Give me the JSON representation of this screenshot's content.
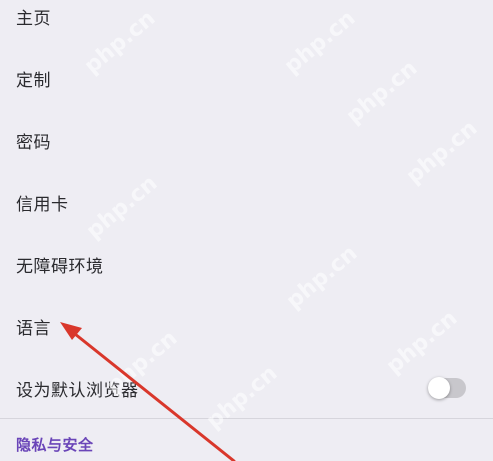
{
  "settings": {
    "items": [
      {
        "label": "主页"
      },
      {
        "label": "定制"
      },
      {
        "label": "密码"
      },
      {
        "label": "信用卡"
      },
      {
        "label": "无障碍环境"
      },
      {
        "label": "语言"
      },
      {
        "label": "设为默认浏览器",
        "toggle": "off"
      }
    ],
    "section_header": "隐私与安全"
  },
  "overlay": {
    "watermark_text": "php.cn",
    "arrow_color": "#d9372b",
    "annotation_target": "语言"
  },
  "colors": {
    "background": "#eeedf3",
    "text": "#2a2a2e",
    "section_header": "#6a45b8",
    "toggle_track": "#c8c7cc"
  }
}
